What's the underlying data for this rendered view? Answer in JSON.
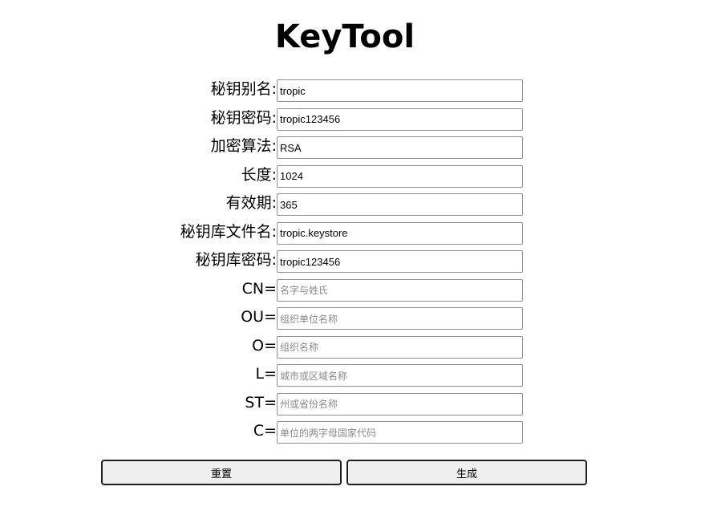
{
  "page": {
    "title": "KeyTool"
  },
  "form": {
    "fields": [
      {
        "label": "秘钥别名:",
        "value": "tropic",
        "placeholder": ""
      },
      {
        "label": "秘钥密码:",
        "value": "tropic123456",
        "placeholder": ""
      },
      {
        "label": "加密算法:",
        "value": "RSA",
        "placeholder": ""
      },
      {
        "label": "长度:",
        "value": "1024",
        "placeholder": ""
      },
      {
        "label": "有效期:",
        "value": "365",
        "placeholder": ""
      },
      {
        "label": "秘钥库文件名:",
        "value": "tropic.keystore",
        "placeholder": ""
      },
      {
        "label": "秘钥库密码:",
        "value": "tropic123456",
        "placeholder": ""
      },
      {
        "label": "CN=",
        "value": "",
        "placeholder": "名字与姓氏"
      },
      {
        "label": "OU=",
        "value": "",
        "placeholder": "组织单位名称"
      },
      {
        "label": "O=",
        "value": "",
        "placeholder": "组织名称"
      },
      {
        "label": "L=",
        "value": "",
        "placeholder": "城市或区域名称"
      },
      {
        "label": "ST=",
        "value": "",
        "placeholder": "州或省份名称"
      },
      {
        "label": "C=",
        "value": "",
        "placeholder": "单位的两字母国家代码"
      }
    ]
  },
  "buttons": {
    "reset_label": "重置",
    "generate_label": "生成"
  }
}
